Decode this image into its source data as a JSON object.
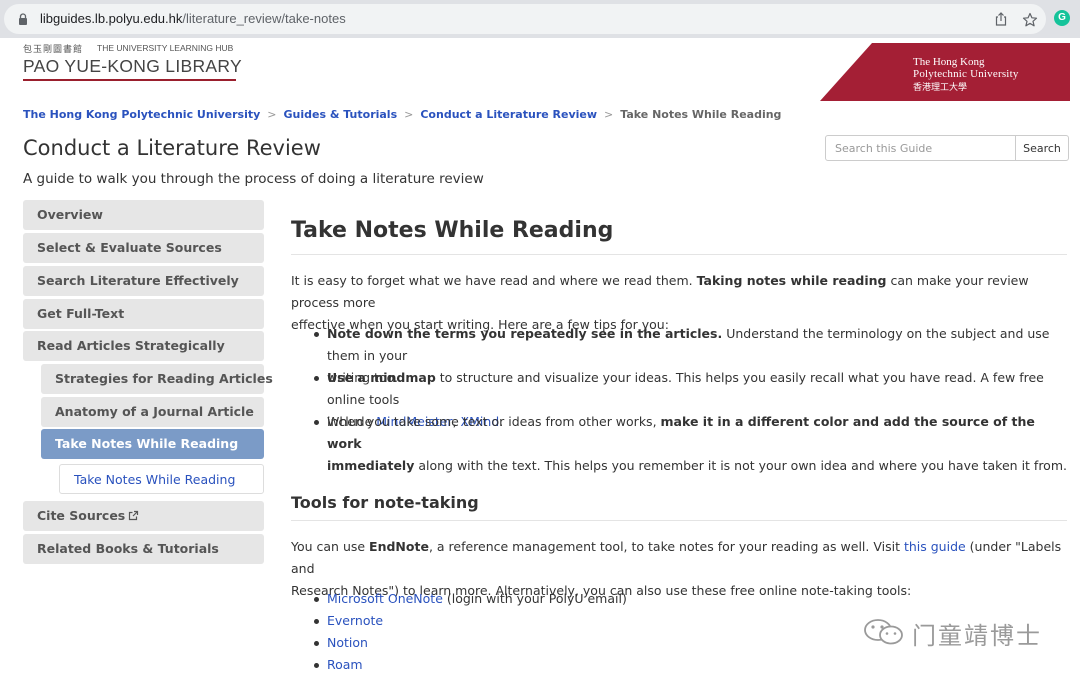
{
  "browser": {
    "url_host": "libguides.lb.polyu.edu.hk",
    "url_path": "/literature_review/take-notes",
    "extension_letter": "G"
  },
  "header": {
    "library_logo": {
      "chinese": "包玉剛圖書館",
      "hub": "THE UNIVERSITY LEARNING HUB",
      "name": "PAO YUE-KONG LIBRARY"
    },
    "university_logo": {
      "line1": "The Hong Kong",
      "line2": "Polytechnic University",
      "chinese": "香港理工大學",
      "color": "#a41f35"
    }
  },
  "breadcrumb": {
    "items": [
      "The Hong Kong Polytechnic University",
      "Guides & Tutorials",
      "Conduct a Literature Review"
    ],
    "separator": ">",
    "current": "Take Notes While Reading"
  },
  "guide": {
    "title": "Conduct a Literature Review",
    "description": "A guide to walk you through the process of doing a literature review"
  },
  "search": {
    "placeholder": "Search this Guide",
    "button": "Search"
  },
  "sidebar": {
    "items": [
      {
        "label": "Overview"
      },
      {
        "label": "Select & Evaluate Sources"
      },
      {
        "label": "Search Literature Effectively"
      },
      {
        "label": "Get Full-Text"
      },
      {
        "label": "Read Articles Strategically"
      },
      {
        "label": "Strategies for Reading Articles"
      },
      {
        "label": "Anatomy of a Journal Article"
      },
      {
        "label": "Take Notes While Reading"
      },
      {
        "label": "Take Notes While Reading"
      },
      {
        "label": "Cite Sources"
      },
      {
        "label": "Related Books & Tutorials"
      }
    ],
    "active_color": "#7b9bc7"
  },
  "main": {
    "heading": "Take Notes While Reading",
    "intro": {
      "before": "It is easy to forget what we have read and where we read them. ",
      "bold": "Taking notes while reading",
      "after_line1": " can make your review process more",
      "line2": "effective when you start writing. Here are a few tips for you:"
    },
    "tips": [
      {
        "bold": "Note down the terms you repeatedly see in the articles.",
        "rest1": " Understand the terminology on the subject and use them in your",
        "rest2": "writing too."
      },
      {
        "bold": "Use a mindmap",
        "rest1": " to structure and visualize your ideas. This helps you easily recall what you have read. A few free online tools",
        "rest2_before": "include ",
        "link1": "MindMeister",
        "comma": ", ",
        "link2": "XMind",
        "end": "."
      },
      {
        "before": "When you take some text or ideas from other works, ",
        "bold1": "make it in a different color and add the source of the work",
        "bold2": "immediately",
        "rest2": " along with the text. This helps you remember it is not your own idea and where you have taken it from."
      }
    ],
    "tools_heading": "Tools for note-taking",
    "tools_intro": {
      "before": "You can use ",
      "bold": "EndNote",
      "mid": ", a reference management tool, to take notes for your reading as well. Visit ",
      "link": "this guide",
      "after": " (under \"Labels and",
      "line2": "Research Notes\") to learn more. Alternatively, you can also use these free online note-taking tools:"
    },
    "tools": [
      {
        "label": "Microsoft OneNote",
        "note": " (login with your PolyU email)"
      },
      {
        "label": "Evernote",
        "note": ""
      },
      {
        "label": "Notion",
        "note": ""
      },
      {
        "label": "Roam",
        "note": ""
      }
    ]
  },
  "watermark": {
    "text": "门童靖博士",
    "icon": "wechat-icon"
  },
  "colors": {
    "link": "#2a52be",
    "text": "#333333",
    "nav_bg": "#e6e6e6"
  }
}
